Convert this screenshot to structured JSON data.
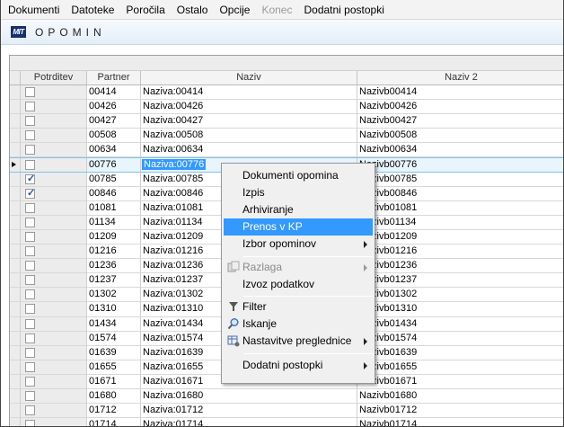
{
  "menubar": {
    "items": [
      {
        "label": "Dokumenti",
        "disabled": false
      },
      {
        "label": "Datoteke",
        "disabled": false
      },
      {
        "label": "Poročila",
        "disabled": false
      },
      {
        "label": "Ostalo",
        "disabled": false
      },
      {
        "label": "Opcije",
        "disabled": false
      },
      {
        "label": "Konec",
        "disabled": true
      },
      {
        "label": "Dodatni postopki",
        "disabled": false
      }
    ]
  },
  "window": {
    "logo_text": "MIT",
    "title": "OPOMIN"
  },
  "grid": {
    "columns": [
      "Potrditev",
      "Partner",
      "Naziv",
      "Naziv 2"
    ],
    "rows": [
      {
        "checked": false,
        "partner": "00414",
        "naziv": "Naziva:00414",
        "naziv2": "Nazivb00414"
      },
      {
        "checked": false,
        "partner": "00426",
        "naziv": "Naziva:00426",
        "naziv2": "Nazivb00426"
      },
      {
        "checked": false,
        "partner": "00427",
        "naziv": "Naziva:00427",
        "naziv2": "Nazivb00427"
      },
      {
        "checked": false,
        "partner": "00508",
        "naziv": "Naziva:00508",
        "naziv2": "Nazivb00508"
      },
      {
        "checked": false,
        "partner": "00634",
        "naziv": "Naziva:00634",
        "naziv2": "Nazivb00634"
      },
      {
        "checked": false,
        "partner": "00776",
        "naziv": "Naziva:00776",
        "naziv2": "Nazivb00776",
        "selected": true
      },
      {
        "checked": true,
        "partner": "00785",
        "naziv": "Naziva:00785",
        "naziv2": "Nazivb00785"
      },
      {
        "checked": true,
        "partner": "00846",
        "naziv": "Naziva:00846",
        "naziv2": "Nazivb00846"
      },
      {
        "checked": false,
        "partner": "01081",
        "naziv": "Naziva:01081",
        "naziv2": "Nazivb01081"
      },
      {
        "checked": false,
        "partner": "01134",
        "naziv": "Naziva:01134",
        "naziv2": "Nazivb01134"
      },
      {
        "checked": false,
        "partner": "01209",
        "naziv": "Naziva:01209",
        "naziv2": "Nazivb01209"
      },
      {
        "checked": false,
        "partner": "01216",
        "naziv": "Naziva:01216",
        "naziv2": "Nazivb01216"
      },
      {
        "checked": false,
        "partner": "01236",
        "naziv": "Naziva:01236",
        "naziv2": "Nazivb01236"
      },
      {
        "checked": false,
        "partner": "01237",
        "naziv": "Naziva:01237",
        "naziv2": "Nazivb01237"
      },
      {
        "checked": false,
        "partner": "01302",
        "naziv": "Naziva:01302",
        "naziv2": "Nazivb01302"
      },
      {
        "checked": false,
        "partner": "01310",
        "naziv": "Naziva:01310",
        "naziv2": "Nazivb01310"
      },
      {
        "checked": false,
        "partner": "01434",
        "naziv": "Naziva:01434",
        "naziv2": "Nazivb01434"
      },
      {
        "checked": false,
        "partner": "01574",
        "naziv": "Naziva:01574",
        "naziv2": "Nazivb01574"
      },
      {
        "checked": false,
        "partner": "01639",
        "naziv": "Naziva:01639",
        "naziv2": "Nazivb01639"
      },
      {
        "checked": false,
        "partner": "01655",
        "naziv": "Naziva:01655",
        "naziv2": "Nazivb01655"
      },
      {
        "checked": false,
        "partner": "01671",
        "naziv": "Naziva:01671",
        "naziv2": "Nazivb01671"
      },
      {
        "checked": false,
        "partner": "01680",
        "naziv": "Naziva:01680",
        "naziv2": "Nazivb01680"
      },
      {
        "checked": false,
        "partner": "01712",
        "naziv": "Naziva:01712",
        "naziv2": "Nazivb01712"
      },
      {
        "checked": false,
        "partner": "01714",
        "naziv": "Naziva:01714",
        "naziv2": "Nazivb01714"
      }
    ]
  },
  "context_menu": {
    "items": [
      {
        "label": "Dokumenti opomina"
      },
      {
        "label": "Izpis"
      },
      {
        "label": "Arhiviranje"
      },
      {
        "label": "Prenos v KP"
      },
      {
        "label": "Izbor opominov"
      },
      {
        "label": "Razlaga"
      },
      {
        "label": "Izvoz podatkov"
      },
      {
        "label": "Filter"
      },
      {
        "label": "Iskanje"
      },
      {
        "label": "Nastavitve preglednice"
      },
      {
        "label": "Dodatni postopki"
      }
    ]
  },
  "colors": {
    "highlight": "#3399ff",
    "selected_row": "#e8f5fc",
    "logo_bg": "#14306e"
  }
}
